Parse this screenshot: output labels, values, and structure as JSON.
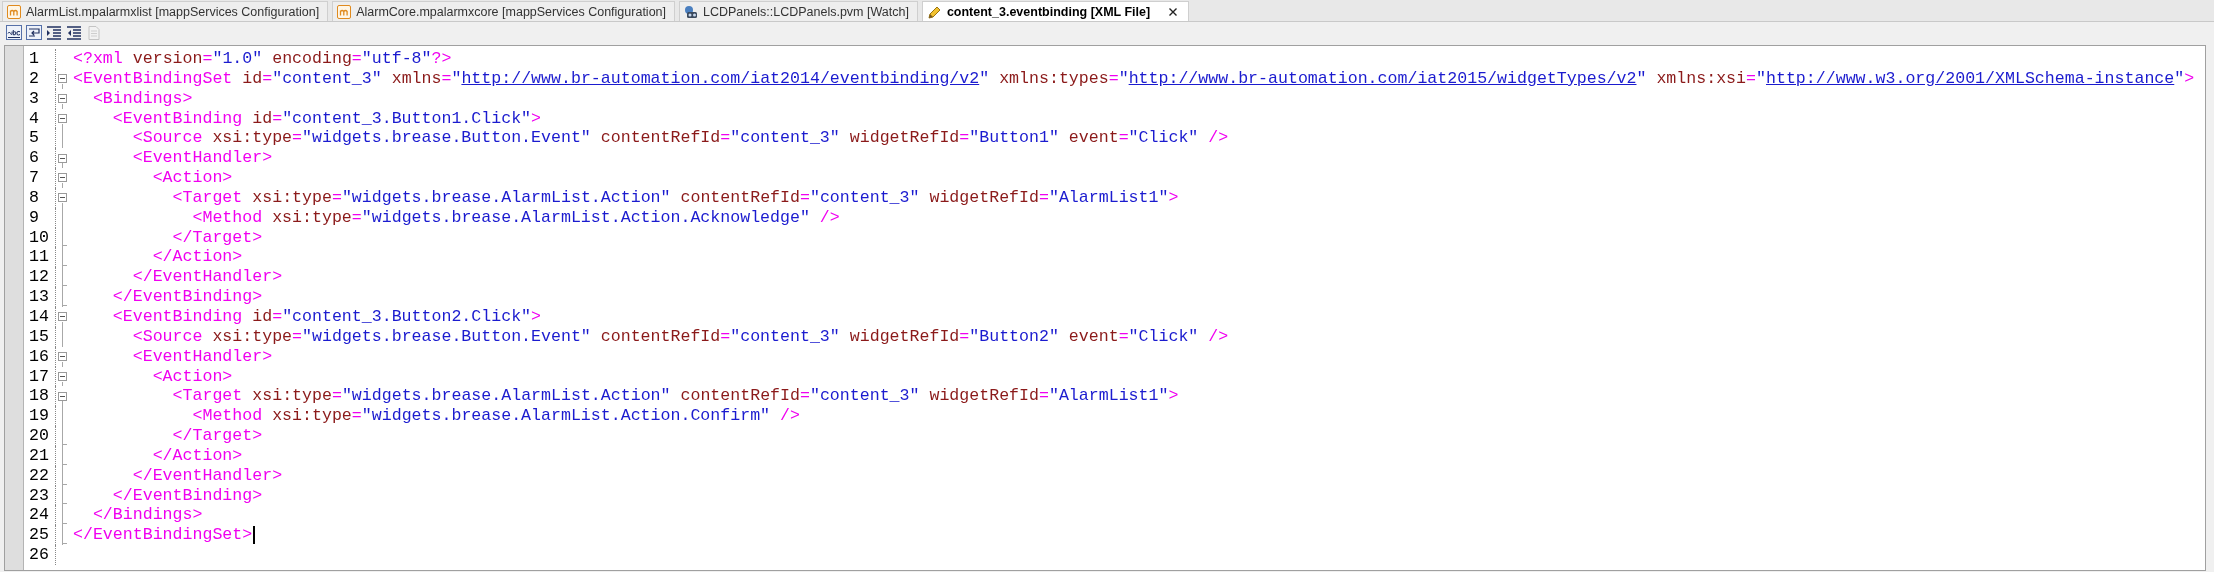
{
  "tabs": [
    {
      "label": "AlarmList.mpalarmxlist [mappServices Configuration]",
      "kind": "config",
      "selected": false
    },
    {
      "label": "AlarmCore.mpalarmxcore [mappServices Configuration]",
      "kind": "config",
      "selected": false
    },
    {
      "label": "LCDPanels::LCDPanels.pvm [Watch]",
      "kind": "watch",
      "selected": false
    },
    {
      "label": "content_3.eventbinding [XML File]",
      "kind": "xml",
      "selected": true
    }
  ],
  "toolbar": [
    {
      "kind": "spell",
      "disabled": false
    },
    {
      "kind": "wrap",
      "disabled": false
    },
    {
      "kind": "indent",
      "disabled": false
    },
    {
      "kind": "outdent",
      "disabled": false
    },
    {
      "kind": "page",
      "disabled": true
    }
  ],
  "lines": [
    {
      "number": "1",
      "kind": "plain",
      "caret": false,
      "tokens": [
        {
          "kind": "tag",
          "text": "<?xml"
        },
        {
          "kind": "attr",
          "text": " version"
        },
        {
          "kind": "eq",
          "text": "="
        },
        {
          "kind": "value",
          "text": "\"1.0\""
        },
        {
          "kind": "attr",
          "text": " encoding"
        },
        {
          "kind": "eq",
          "text": "="
        },
        {
          "kind": "value",
          "text": "\"utf-8\""
        },
        {
          "kind": "tag",
          "text": "?>"
        }
      ]
    },
    {
      "number": "2",
      "kind": "foldstart",
      "caret": false,
      "tokens": [
        {
          "kind": "tag",
          "text": "<EventBindingSet"
        },
        {
          "kind": "attr",
          "text": " id"
        },
        {
          "kind": "eq",
          "text": "="
        },
        {
          "kind": "value",
          "text": "\"content_3\""
        },
        {
          "kind": "attr",
          "text": " xmlns"
        },
        {
          "kind": "eq",
          "text": "="
        },
        {
          "kind": "value",
          "text": "\""
        },
        {
          "kind": "link",
          "text": "http://www.br-automation.com/iat2014/eventbinding/v2"
        },
        {
          "kind": "value",
          "text": "\""
        },
        {
          "kind": "attr",
          "text": " xmlns:types"
        },
        {
          "kind": "eq",
          "text": "="
        },
        {
          "kind": "value",
          "text": "\""
        },
        {
          "kind": "link",
          "text": "http://www.br-automation.com/iat2015/widgetTypes/v2"
        },
        {
          "kind": "value",
          "text": "\""
        },
        {
          "kind": "attr",
          "text": " xmlns:xsi"
        },
        {
          "kind": "eq",
          "text": "="
        },
        {
          "kind": "value",
          "text": "\""
        },
        {
          "kind": "link",
          "text": "http://www.w3.org/2001/XMLSchema-instance"
        },
        {
          "kind": "value",
          "text": "\""
        },
        {
          "kind": "tag",
          "text": ">"
        }
      ]
    },
    {
      "number": "3",
      "kind": "foldstart",
      "caret": false,
      "tokens": [
        {
          "kind": "tag",
          "text": "  <Bindings>"
        }
      ]
    },
    {
      "number": "4",
      "kind": "foldstart",
      "caret": false,
      "tokens": [
        {
          "kind": "tag",
          "text": "    <EventBinding"
        },
        {
          "kind": "attr",
          "text": " id"
        },
        {
          "kind": "eq",
          "text": "="
        },
        {
          "kind": "value",
          "text": "\"content_3.Button1.Click\""
        },
        {
          "kind": "tag",
          "text": ">"
        }
      ]
    },
    {
      "number": "5",
      "kind": "foldmid",
      "caret": false,
      "tokens": [
        {
          "kind": "tag",
          "text": "      <Source"
        },
        {
          "kind": "attr",
          "text": " xsi:type"
        },
        {
          "kind": "eq",
          "text": "="
        },
        {
          "kind": "value",
          "text": "\"widgets.brease.Button.Event\""
        },
        {
          "kind": "attr",
          "text": " contentRefId"
        },
        {
          "kind": "eq",
          "text": "="
        },
        {
          "kind": "value",
          "text": "\"content_3\""
        },
        {
          "kind": "attr",
          "text": " widgetRefId"
        },
        {
          "kind": "eq",
          "text": "="
        },
        {
          "kind": "value",
          "text": "\"Button1\""
        },
        {
          "kind": "attr",
          "text": " event"
        },
        {
          "kind": "eq",
          "text": "="
        },
        {
          "kind": "value",
          "text": "\"Click\""
        },
        {
          "kind": "tag",
          "text": " />"
        }
      ]
    },
    {
      "number": "6",
      "kind": "foldstart",
      "caret": false,
      "tokens": [
        {
          "kind": "tag",
          "text": "      <EventHandler>"
        }
      ]
    },
    {
      "number": "7",
      "kind": "foldstart",
      "caret": false,
      "tokens": [
        {
          "kind": "tag",
          "text": "        <Action>"
        }
      ]
    },
    {
      "number": "8",
      "kind": "foldstart",
      "caret": false,
      "tokens": [
        {
          "kind": "tag",
          "text": "          <Target"
        },
        {
          "kind": "attr",
          "text": " xsi:type"
        },
        {
          "kind": "eq",
          "text": "="
        },
        {
          "kind": "value",
          "text": "\"widgets.brease.AlarmList.Action\""
        },
        {
          "kind": "attr",
          "text": " contentRefId"
        },
        {
          "kind": "eq",
          "text": "="
        },
        {
          "kind": "value",
          "text": "\"content_3\""
        },
        {
          "kind": "attr",
          "text": " widgetRefId"
        },
        {
          "kind": "eq",
          "text": "="
        },
        {
          "kind": "value",
          "text": "\"AlarmList1\""
        },
        {
          "kind": "tag",
          "text": ">"
        }
      ]
    },
    {
      "number": "9",
      "kind": "foldmid",
      "caret": false,
      "tokens": [
        {
          "kind": "tag",
          "text": "            <Method"
        },
        {
          "kind": "attr",
          "text": " xsi:type"
        },
        {
          "kind": "eq",
          "text": "="
        },
        {
          "kind": "value",
          "text": "\"widgets.brease.AlarmList.Action.Acknowledge\""
        },
        {
          "kind": "tag",
          "text": " />"
        }
      ]
    },
    {
      "number": "10",
      "kind": "foldend",
      "caret": false,
      "tokens": [
        {
          "kind": "tag",
          "text": "          </Target>"
        }
      ]
    },
    {
      "number": "11",
      "kind": "foldend",
      "caret": false,
      "tokens": [
        {
          "kind": "tag",
          "text": "        </Action>"
        }
      ]
    },
    {
      "number": "12",
      "kind": "foldend",
      "caret": false,
      "tokens": [
        {
          "kind": "tag",
          "text": "      </EventHandler>"
        }
      ]
    },
    {
      "number": "13",
      "kind": "foldend",
      "caret": false,
      "tokens": [
        {
          "kind": "tag",
          "text": "    </EventBinding>"
        }
      ]
    },
    {
      "number": "14",
      "kind": "foldstart",
      "caret": false,
      "tokens": [
        {
          "kind": "tag",
          "text": "    <EventBinding"
        },
        {
          "kind": "attr",
          "text": " id"
        },
        {
          "kind": "eq",
          "text": "="
        },
        {
          "kind": "value",
          "text": "\"content_3.Button2.Click\""
        },
        {
          "kind": "tag",
          "text": ">"
        }
      ]
    },
    {
      "number": "15",
      "kind": "foldmid",
      "caret": false,
      "tokens": [
        {
          "kind": "tag",
          "text": "      <Source"
        },
        {
          "kind": "attr",
          "text": " xsi:type"
        },
        {
          "kind": "eq",
          "text": "="
        },
        {
          "kind": "value",
          "text": "\"widgets.brease.Button.Event\""
        },
        {
          "kind": "attr",
          "text": " contentRefId"
        },
        {
          "kind": "eq",
          "text": "="
        },
        {
          "kind": "value",
          "text": "\"content_3\""
        },
        {
          "kind": "attr",
          "text": " widgetRefId"
        },
        {
          "kind": "eq",
          "text": "="
        },
        {
          "kind": "value",
          "text": "\"Button2\""
        },
        {
          "kind": "attr",
          "text": " event"
        },
        {
          "kind": "eq",
          "text": "="
        },
        {
          "kind": "value",
          "text": "\"Click\""
        },
        {
          "kind": "tag",
          "text": " />"
        }
      ]
    },
    {
      "number": "16",
      "kind": "foldstart",
      "caret": false,
      "tokens": [
        {
          "kind": "tag",
          "text": "      <EventHandler>"
        }
      ]
    },
    {
      "number": "17",
      "kind": "foldstart",
      "caret": false,
      "tokens": [
        {
          "kind": "tag",
          "text": "        <Action>"
        }
      ]
    },
    {
      "number": "18",
      "kind": "foldstart",
      "caret": false,
      "tokens": [
        {
          "kind": "tag",
          "text": "          <Target"
        },
        {
          "kind": "attr",
          "text": " xsi:type"
        },
        {
          "kind": "eq",
          "text": "="
        },
        {
          "kind": "value",
          "text": "\"widgets.brease.AlarmList.Action\""
        },
        {
          "kind": "attr",
          "text": " contentRefId"
        },
        {
          "kind": "eq",
          "text": "="
        },
        {
          "kind": "value",
          "text": "\"content_3\""
        },
        {
          "kind": "attr",
          "text": " widgetRefId"
        },
        {
          "kind": "eq",
          "text": "="
        },
        {
          "kind": "value",
          "text": "\"AlarmList1\""
        },
        {
          "kind": "tag",
          "text": ">"
        }
      ]
    },
    {
      "number": "19",
      "kind": "foldmid",
      "caret": false,
      "tokens": [
        {
          "kind": "tag",
          "text": "            <Method"
        },
        {
          "kind": "attr",
          "text": " xsi:type"
        },
        {
          "kind": "eq",
          "text": "="
        },
        {
          "kind": "value",
          "text": "\"widgets.brease.AlarmList.Action.Confirm\""
        },
        {
          "kind": "tag",
          "text": " />"
        }
      ]
    },
    {
      "number": "20",
      "kind": "foldend",
      "caret": false,
      "tokens": [
        {
          "kind": "tag",
          "text": "          </Target>"
        }
      ]
    },
    {
      "number": "21",
      "kind": "foldend",
      "caret": false,
      "tokens": [
        {
          "kind": "tag",
          "text": "        </Action>"
        }
      ]
    },
    {
      "number": "22",
      "kind": "foldend",
      "caret": false,
      "tokens": [
        {
          "kind": "tag",
          "text": "      </EventHandler>"
        }
      ]
    },
    {
      "number": "23",
      "kind": "foldend",
      "caret": false,
      "tokens": [
        {
          "kind": "tag",
          "text": "    </EventBinding>"
        }
      ]
    },
    {
      "number": "24",
      "kind": "foldend",
      "caret": false,
      "tokens": [
        {
          "kind": "tag",
          "text": "  </Bindings>"
        }
      ]
    },
    {
      "number": "25",
      "kind": "foldend",
      "caret": true,
      "tokens": [
        {
          "kind": "tag",
          "text": "</EventBindingSet>"
        }
      ]
    },
    {
      "number": "26",
      "kind": "plain",
      "caret": false
    }
  ]
}
